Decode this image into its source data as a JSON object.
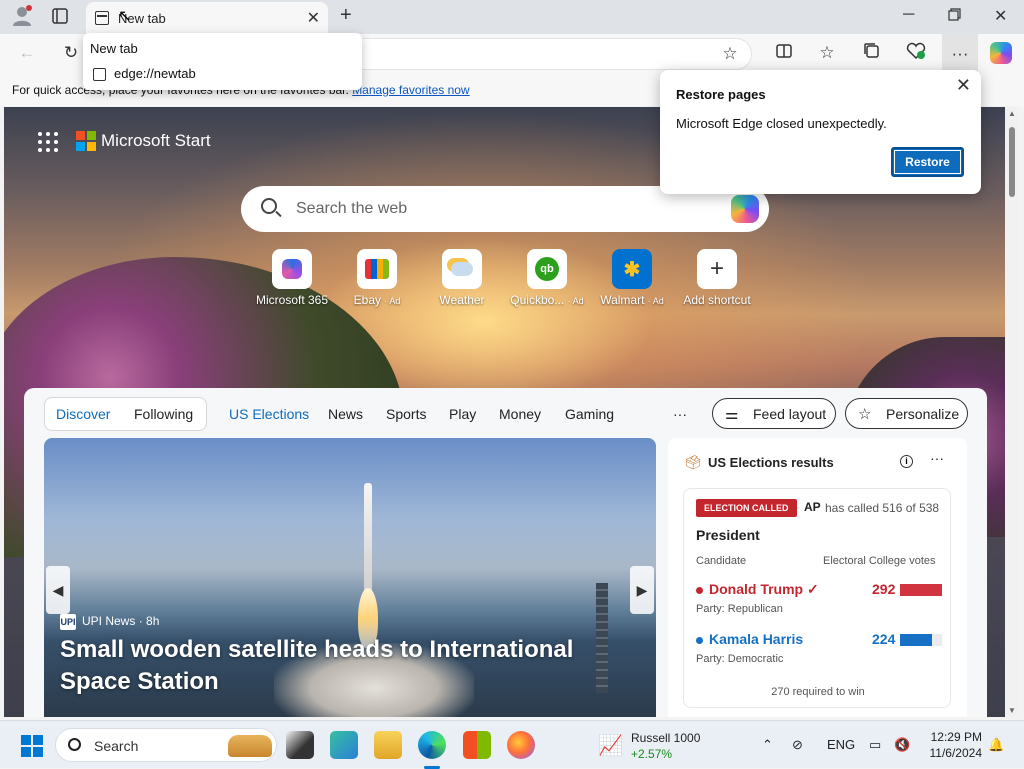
{
  "browser": {
    "tab_title": "New tab",
    "tab_dropdown": {
      "title": "New tab",
      "url": "edge://newtab"
    },
    "favbar": {
      "text": "For quick access, place your favorites here on the favorites bar.",
      "link": "Manage favorites now"
    }
  },
  "restore_popup": {
    "title": "Restore pages",
    "message": "Microsoft Edge closed unexpectedly.",
    "button": "Restore"
  },
  "newtab": {
    "brand": "Microsoft Start",
    "search_placeholder": "Search the web",
    "shortcuts": [
      {
        "label": "Microsoft 365",
        "ad": ""
      },
      {
        "label": "Ebay",
        "ad": "· Ad"
      },
      {
        "label": "Weather",
        "ad": ""
      },
      {
        "label": "Quickbo...",
        "ad": "· Ad"
      },
      {
        "label": "Walmart",
        "ad": "· Ad"
      },
      {
        "label": "Add shortcut",
        "ad": ""
      }
    ],
    "nav": {
      "discover": "Discover",
      "following": "Following",
      "tabs": [
        "US Elections",
        "News",
        "Sports",
        "Play",
        "Money",
        "Gaming"
      ],
      "more": "···",
      "feed_layout": "Feed layout",
      "personalize": "Personalize"
    },
    "hero": {
      "source": "UPI News",
      "age": "· 8h",
      "source_logo": "UPI",
      "headline": "Small wooden satellite heads to International Space Station"
    },
    "elections": {
      "title": "US Elections results",
      "badge": "ELECTION CALLED",
      "ap": "AP",
      "called_text": "has called 516 of 538",
      "race": "President",
      "col_candidate": "Candidate",
      "col_votes": "Electoral College votes",
      "candidates": [
        {
          "name": "Donald Trump",
          "check": "✓",
          "party": "Party: Republican",
          "votes": "292",
          "share": 1.0,
          "color": "#d1343e"
        },
        {
          "name": "Kamala Harris",
          "check": "",
          "party": "Party: Democratic",
          "votes": "224",
          "share": 0.77,
          "color": "#1670c4"
        }
      ],
      "required": "270 required to win"
    }
  },
  "taskbar": {
    "search": "Search",
    "stock_name": "Russell 1000",
    "stock_change": "+2.57%",
    "lang": "ENG",
    "time": "12:29 PM",
    "date": "11/6/2024"
  },
  "colors": {
    "accent": "#0f6cbd",
    "republican": "#d1343e",
    "democrat": "#1670c4"
  }
}
